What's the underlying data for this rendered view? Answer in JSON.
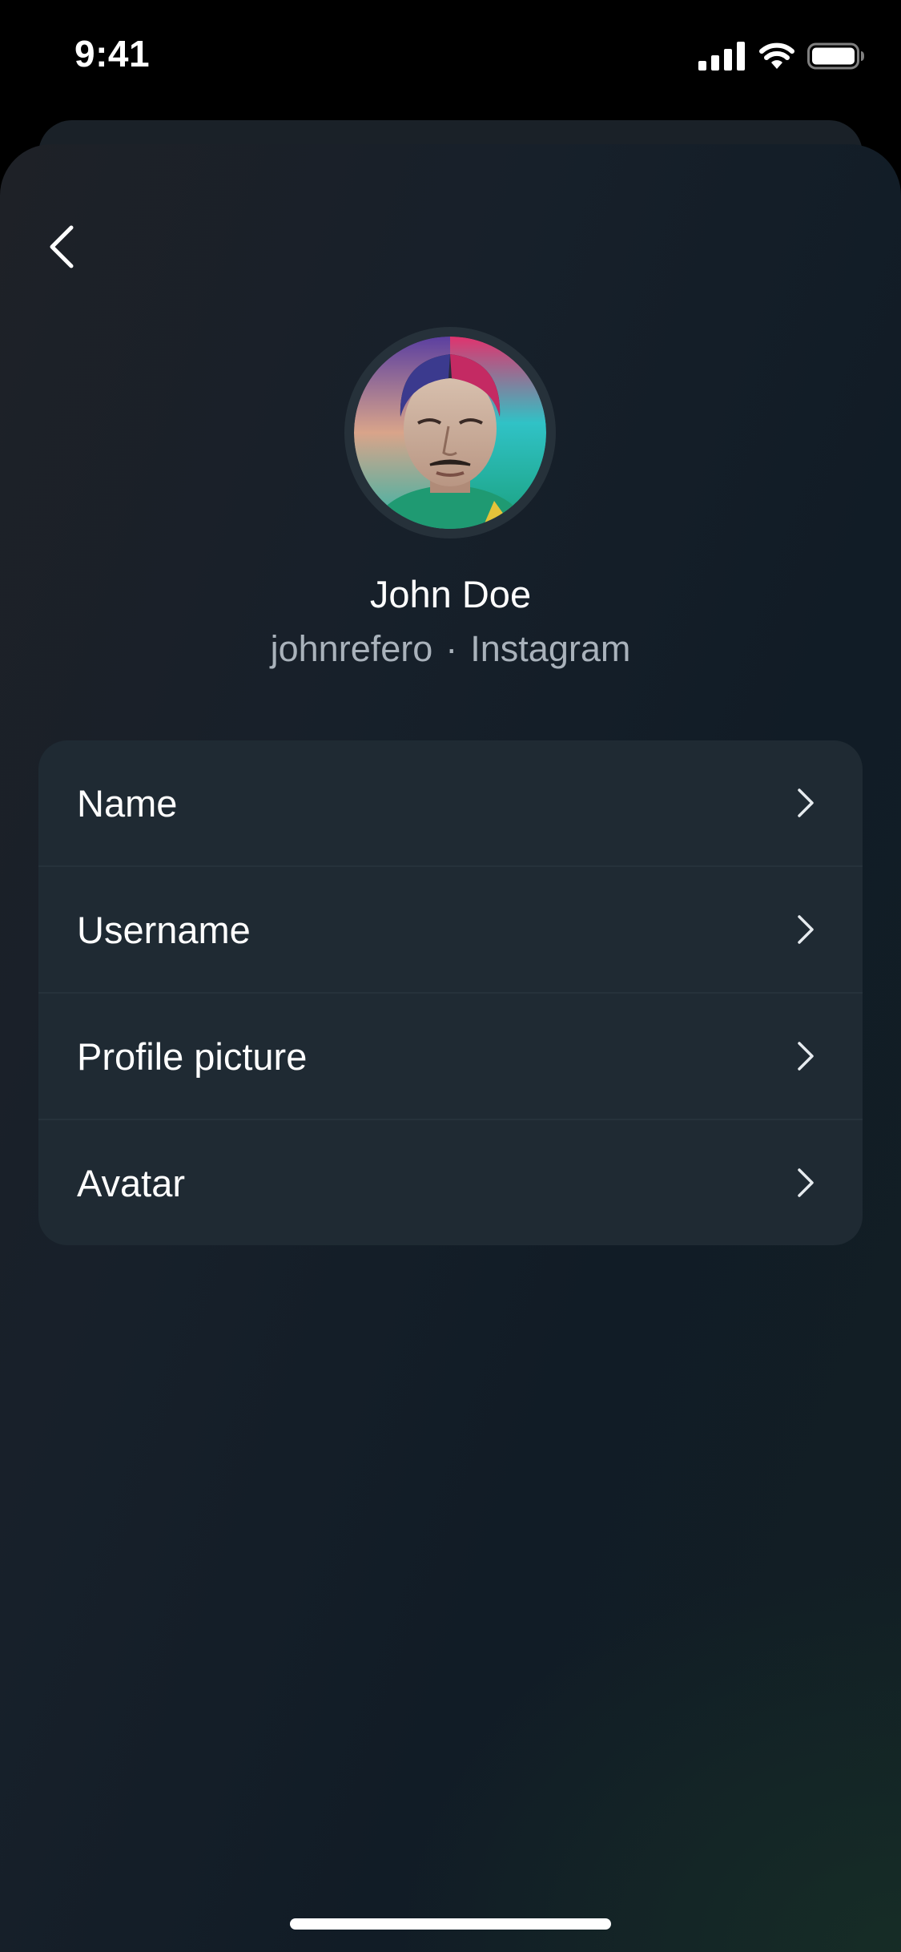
{
  "status_bar": {
    "time": "9:41",
    "icons": [
      "cellular-signal-icon",
      "wifi-icon",
      "battery-icon"
    ]
  },
  "header": {
    "back_icon": "chevron-left-icon"
  },
  "profile": {
    "name": "John Doe",
    "username": "johnrefero",
    "separator": "·",
    "platform": "Instagram"
  },
  "menu": {
    "items": [
      {
        "label": "Name",
        "icon": "chevron-right-icon"
      },
      {
        "label": "Username",
        "icon": "chevron-right-icon"
      },
      {
        "label": "Profile picture",
        "icon": "chevron-right-icon"
      },
      {
        "label": "Avatar",
        "icon": "chevron-right-icon"
      }
    ]
  },
  "colors": {
    "background": "#000000",
    "sheet": "#17202a",
    "card": "#1f2a33",
    "text_primary": "#ffffff",
    "text_secondary": "#a9b2bb"
  }
}
